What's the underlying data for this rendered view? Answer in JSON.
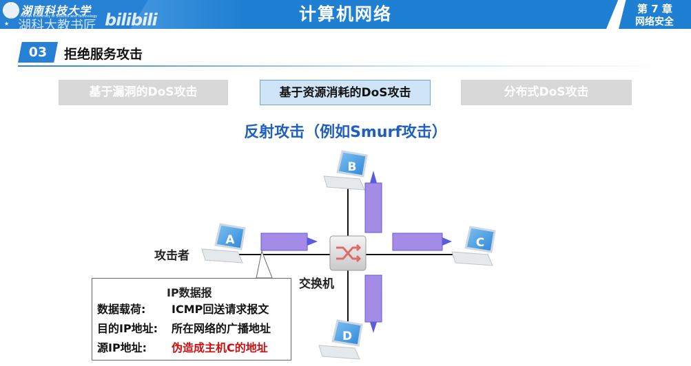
{
  "header": {
    "school_name": "湖南科技大学",
    "school_name_en": "Hunan University of Science and Technology",
    "watermark": "湖科大教书匠",
    "bili_logo": "bilibili",
    "title": "计算机网络",
    "chapter_number": "第 7 章",
    "chapter_name": "网络安全"
  },
  "section": {
    "number": "03",
    "title": "拒绝服务攻击"
  },
  "tabs": [
    {
      "label": "基于漏洞的DoS攻击",
      "active": false
    },
    {
      "label": "基于资源消耗的DoS攻击",
      "active": true
    },
    {
      "label": "分布式DoS攻击",
      "active": false
    }
  ],
  "heading": "反射攻击（例如Smurf攻击）",
  "diagram": {
    "attacker_label": "攻击者",
    "switch_label": "交换机",
    "hosts": [
      {
        "id": "A"
      },
      {
        "id": "B"
      },
      {
        "id": "C"
      },
      {
        "id": "D"
      }
    ],
    "packet": {
      "title": "IP数据报",
      "payload_label": "数据载荷:",
      "payload_value": "ICMP回送请求报文",
      "dst_label": "目的IP地址:",
      "dst_value": "所在网络的广播地址",
      "src_label": "源IP地址:",
      "src_value": "伪造成主机C的地址"
    }
  },
  "colors": {
    "header_blue": "#1f7fd2",
    "heading_blue": "#1f5fbf",
    "packet_purple": "#a48ce6",
    "arrow_blue": "#5b5be0",
    "highlight_red": "#d01010"
  }
}
